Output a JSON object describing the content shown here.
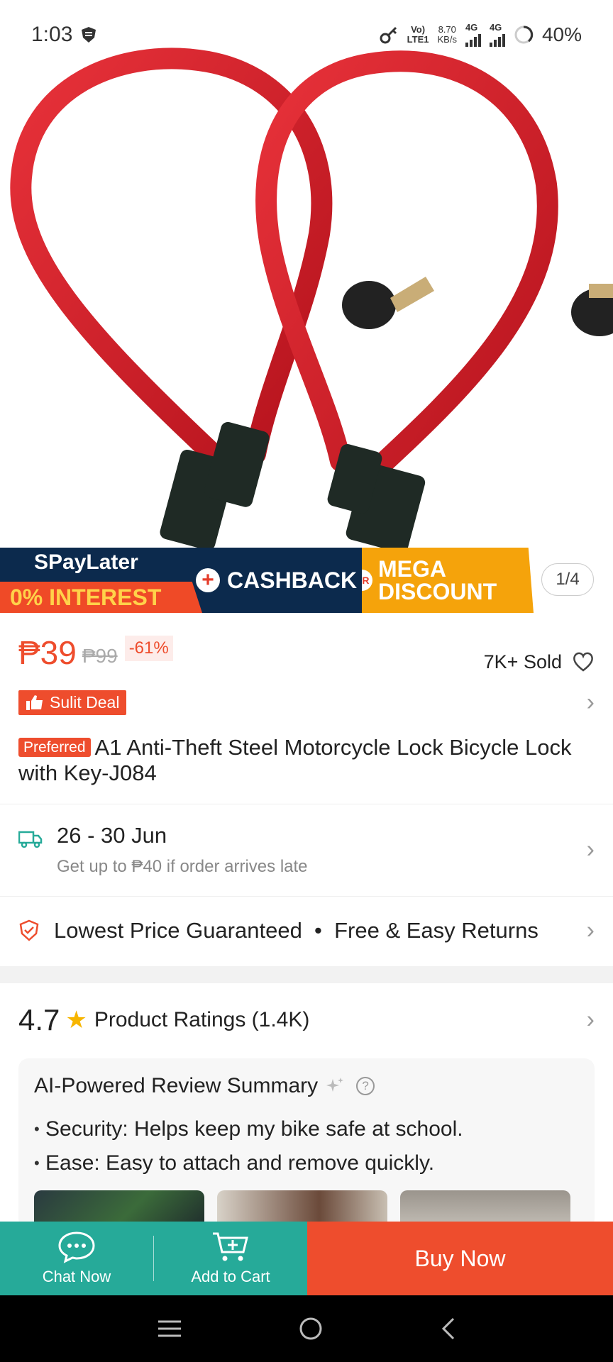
{
  "status_bar": {
    "time": "1:03",
    "volte": "Vo)",
    "lte": "LTE1",
    "speed_value": "8.70",
    "speed_unit": "KB/s",
    "net1": "4G",
    "net2": "4G",
    "battery": "40%"
  },
  "gallery": {
    "counter": "1/4"
  },
  "promo": {
    "spaylater": "SPayLater",
    "interest": "0% INTEREST",
    "plus": "+",
    "cashback": "CASHBACK",
    "or": "OR",
    "mega_line1": "MEGA",
    "mega_line2": "DISCOUNT"
  },
  "price": {
    "current": "₱39",
    "original": "₱99",
    "discount": "-61%",
    "sold": "7K+ Sold"
  },
  "deal": {
    "label": "Sulit Deal"
  },
  "product": {
    "badge": "Preferred",
    "title": "A1 Anti-Theft Steel Motorcycle Lock Bicycle Lock with Key-J084"
  },
  "delivery": {
    "date": "26 - 30 Jun",
    "note": "Get up to ₱40 if order arrives late"
  },
  "guarantee": {
    "text": "Lowest Price Guaranteed  •  Free & Easy Returns"
  },
  "ratings": {
    "score": "4.7",
    "label": "Product Ratings (1.4K)"
  },
  "ai_summary": {
    "title": "AI-Powered Review Summary",
    "points": [
      "Security: Helps keep my bike safe at school.",
      "Ease: Easy to attach and remove quickly."
    ]
  },
  "actions": {
    "chat": "Chat Now",
    "cart": "Add to Cart",
    "buy": "Buy Now"
  },
  "colors": {
    "brand": "#ee4d2d",
    "teal": "#26aa99",
    "star": "#f7b500"
  }
}
